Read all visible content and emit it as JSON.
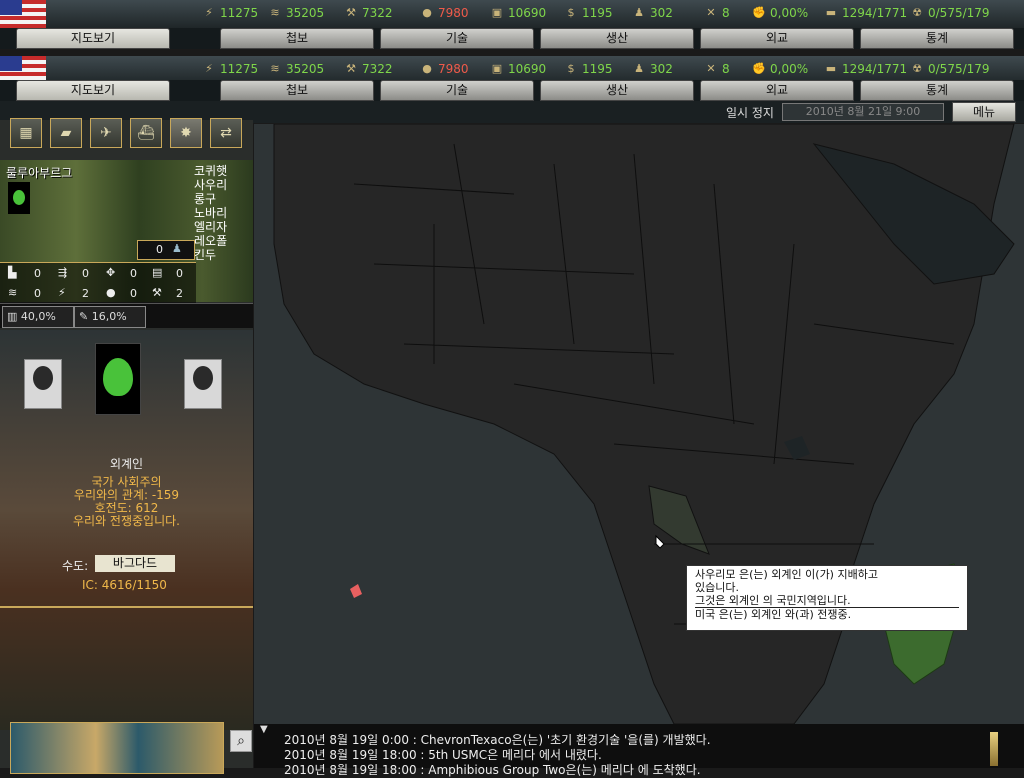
{
  "resources": [
    {
      "icon": "energy-icon",
      "value": "11275"
    },
    {
      "icon": "metal-icon",
      "value": "35205"
    },
    {
      "icon": "rare-materials-icon",
      "value": "7322"
    },
    {
      "icon": "oil-icon",
      "value": "7980"
    },
    {
      "icon": "supplies-icon",
      "value": "10690"
    },
    {
      "icon": "money-icon",
      "value": "1195"
    },
    {
      "icon": "manpower-icon",
      "value": "302"
    },
    {
      "icon": "transport-icon",
      "value": "8"
    },
    {
      "icon": "dissent-icon",
      "value": "0,00%"
    },
    {
      "icon": "convoy-icon",
      "value": "1294/1771"
    },
    {
      "icon": "nukes-icon",
      "value": "0/575/179"
    }
  ],
  "tabs": [
    "지도보기",
    "첩보",
    "기술",
    "생산",
    "외교",
    "통계"
  ],
  "status": {
    "paused": "일시 정지",
    "date": "2010년 8월 21일 9:00",
    "menu": "메뉴"
  },
  "unit_buttons": [
    "land-map-icon",
    "tank-icon",
    "plane-icon",
    "ship-icon",
    "explosion-icon",
    "minister-icon"
  ],
  "province": {
    "name": "룰루아부르그",
    "terrain_list": [
      "코퀴햇",
      "사우리",
      "롱구",
      "노바리",
      "엘리자",
      "레오폴",
      "킨두"
    ],
    "manpower": "0",
    "stats": [
      "0",
      "0",
      "0",
      "0",
      "0",
      "2",
      "0",
      "2"
    ],
    "attr1": "40,0%",
    "attr2": "16,0%"
  },
  "country": {
    "name": "외계인",
    "gov": "국가 사회주의",
    "relation": "우리와의 관계: -159",
    "belligerence": "호전도: 612",
    "war": "우리와 전쟁중입니다.",
    "capital_label": "수도:",
    "capital": "바그다드",
    "ic": "IC: 4616/1150"
  },
  "tooltip": {
    "line1": "사우리모 은(는) 외계인 이(가) 지배하고",
    "line2": "있습니다.",
    "line3": "그것은 외계인 의 국민지역입니다.",
    "line4": "미국 은(는) 외계인 와(과) 전쟁중."
  },
  "log": [
    "2010년 8월 19일 0:00  : ChevronTexaco은(는) '초기 환경기술 '을(를) 개발했다.",
    "2010년 8월 19일 18:00  : 5th USMC은 메리다 에서 내렸다.",
    "2010년 8월 19일 18:00  : Amphibious Group Two은(는) 메리다 에 도착했다."
  ],
  "colors": {
    "accent": "#c9a85a",
    "positive": "#7fd64a",
    "negative": "#ef5a4a",
    "alien": "#49c23a"
  }
}
